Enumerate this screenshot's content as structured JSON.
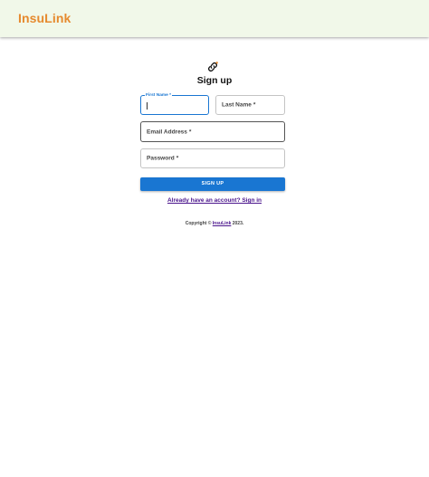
{
  "header": {
    "brand": "InsuLink"
  },
  "icons": {
    "logo": "link-icon"
  },
  "colors": {
    "brand": "#e68a2e",
    "primary": "#1976d2",
    "link": "#4a148c",
    "header_bg": "#f1f8e9"
  },
  "form": {
    "title": "Sign up",
    "first_name": {
      "label": "First Name",
      "required_mark": "*",
      "value": ""
    },
    "last_name": {
      "label": "Last Name",
      "required_mark": "*",
      "value": ""
    },
    "email": {
      "label": "Email Address",
      "required_mark": "*",
      "value": ""
    },
    "password": {
      "label": "Password",
      "required_mark": "*",
      "value": ""
    },
    "submit_label": "SIGN UP",
    "signin_link": "Already have an account? Sign in"
  },
  "footer": {
    "prefix": "Copyright © ",
    "brand": "InsuLink",
    "suffix": " 2023."
  }
}
